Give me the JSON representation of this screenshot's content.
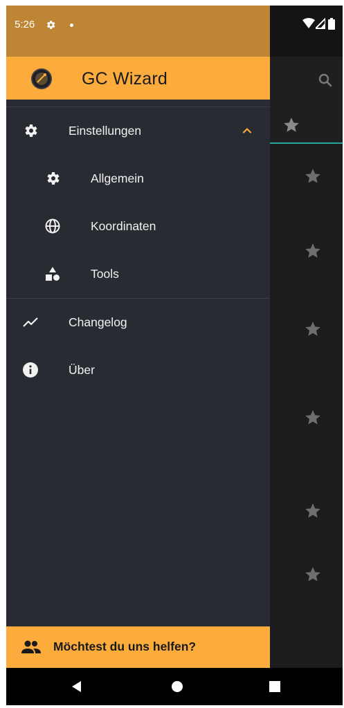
{
  "status_bar": {
    "time": "5:26"
  },
  "drawer": {
    "app_title": "GC Wizard",
    "settings": {
      "label": "Einstellungen",
      "expanded": true,
      "children": [
        {
          "label": "Allgemein",
          "icon": "gear-icon"
        },
        {
          "label": "Koordinaten",
          "icon": "globe-icon"
        },
        {
          "label": "Tools",
          "icon": "shapes-icon"
        }
      ]
    },
    "items": [
      {
        "label": "Changelog",
        "icon": "trend-icon"
      },
      {
        "label": "Über",
        "icon": "info-icon"
      }
    ],
    "help_label": "Möchtest du uns helfen?"
  },
  "colors": {
    "accent": "#fbac3c",
    "status_bar": "#be8534",
    "drawer_bg": "#282b31",
    "tab_indicator": "#26a69a"
  }
}
